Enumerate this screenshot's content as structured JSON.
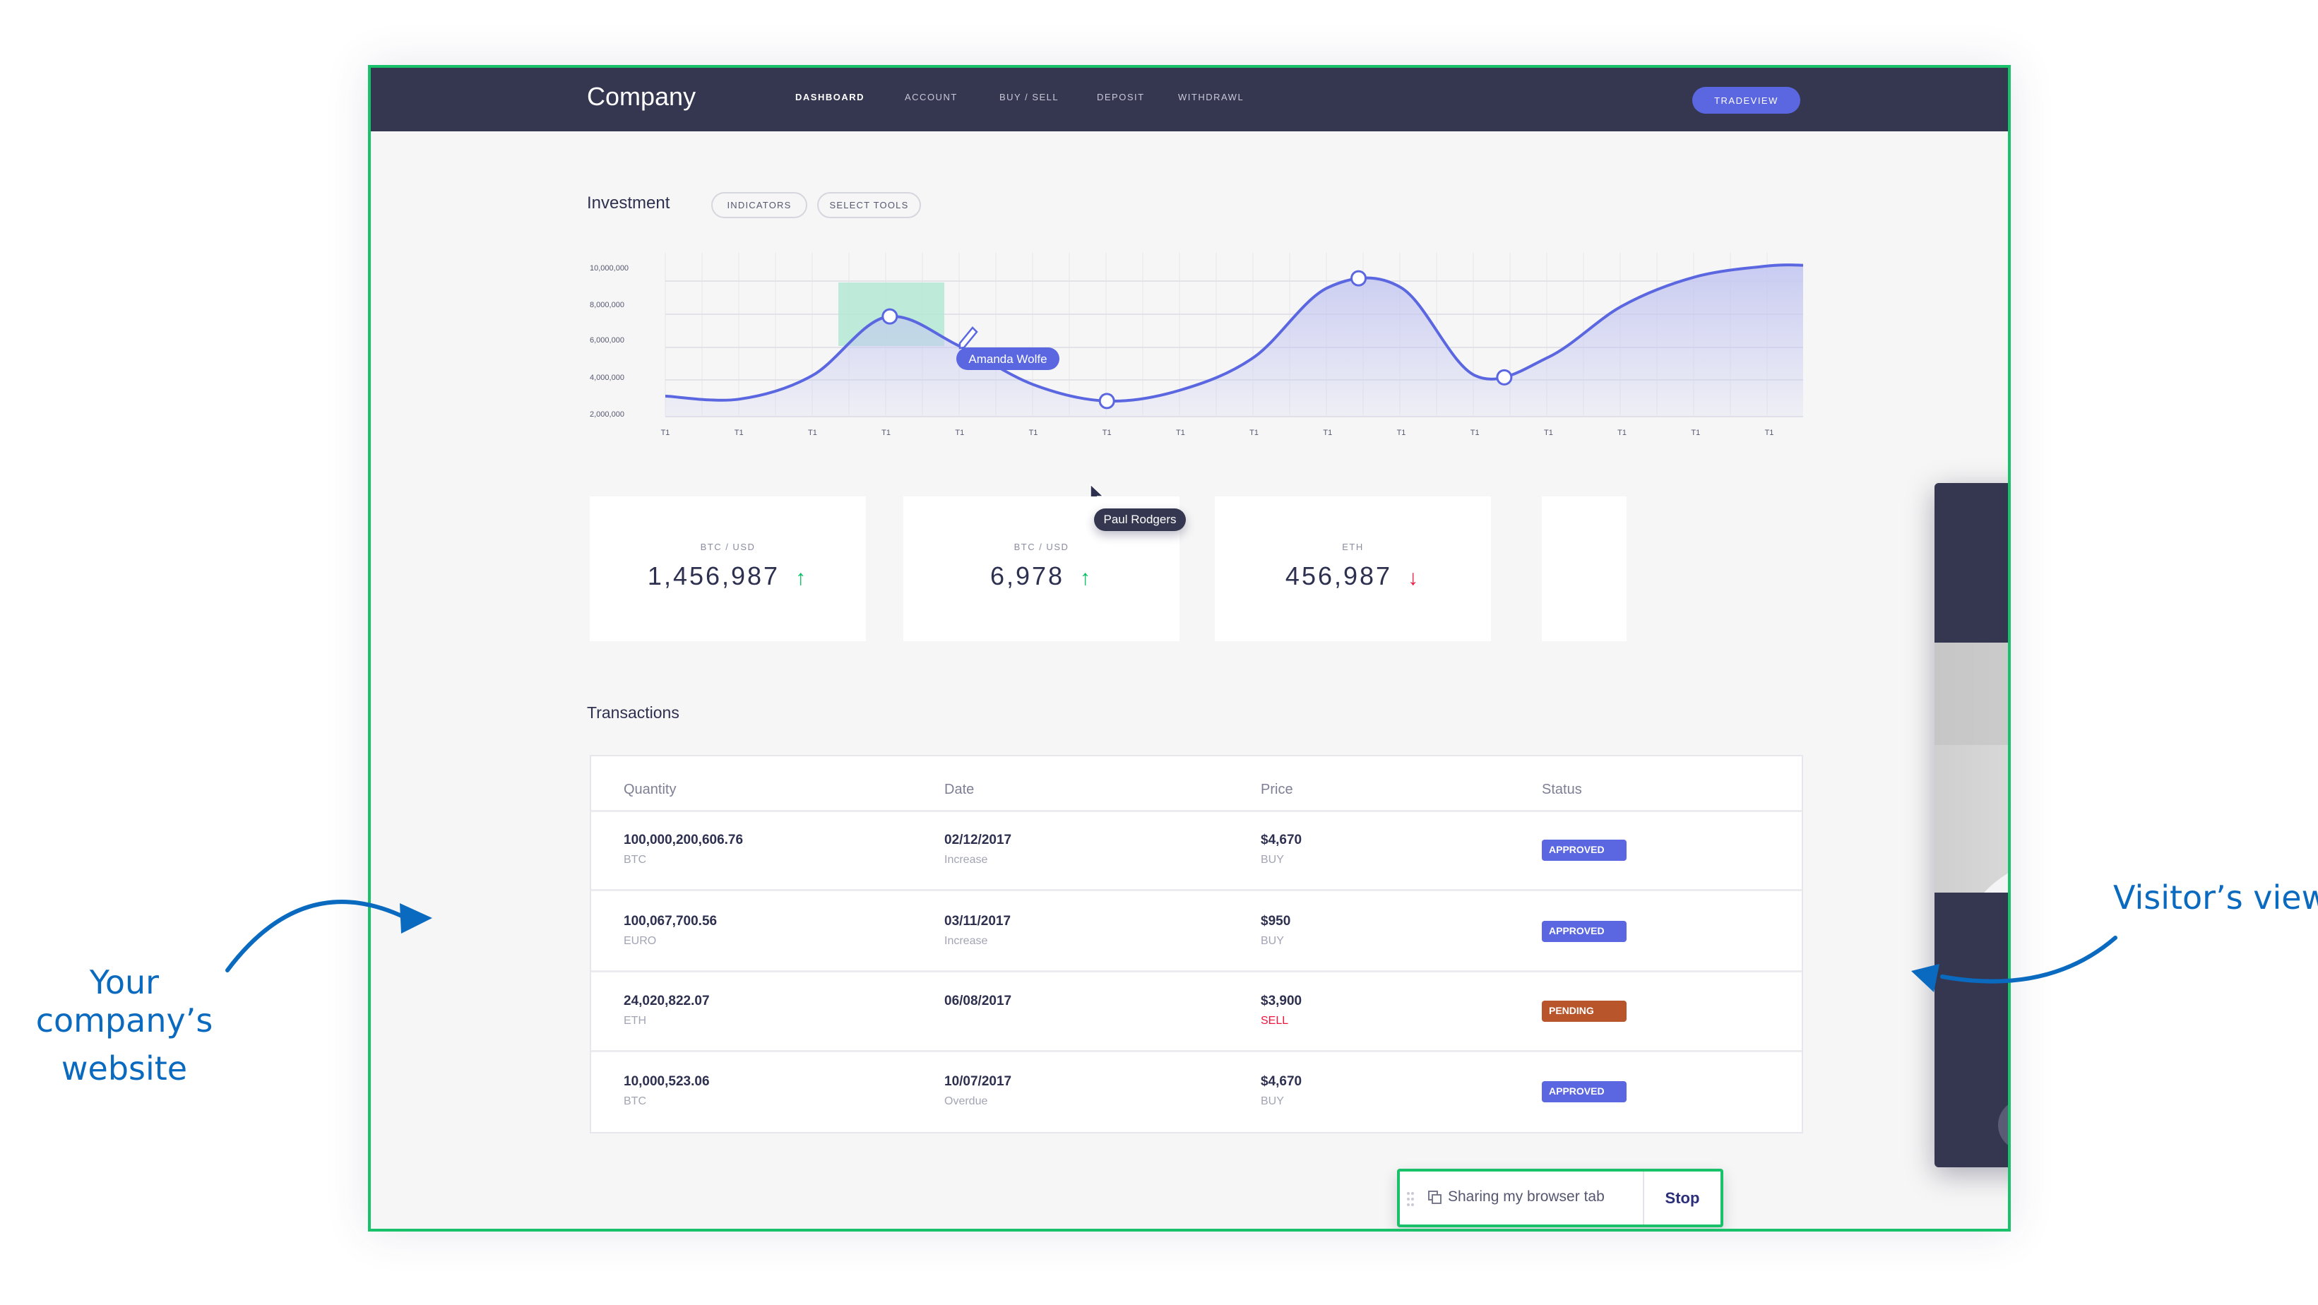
{
  "annotations": {
    "left_line1": "Your company’s",
    "left_line2": "website",
    "right": "Visitor’s view",
    "color": "#0a6abf"
  },
  "colors": {
    "nav": "#353650",
    "accent": "#5a67e0",
    "up": "#00c060",
    "down": "#f0143c",
    "frame_border": "#19c16a"
  },
  "header": {
    "brand": "Company",
    "nav": [
      {
        "label": "DASHBOARD",
        "active": true
      },
      {
        "label": "ACCOUNT"
      },
      {
        "label": "BUY / SELL"
      },
      {
        "label": "DEPOSIT"
      },
      {
        "label": "WITHDRAWL"
      }
    ],
    "cta": "TRADEVIEW"
  },
  "investment": {
    "title": "Investment",
    "buttons": [
      "INDICATORS",
      "SELECT TOOLS"
    ]
  },
  "chart_data": {
    "type": "area",
    "x": [
      "T1",
      "T1",
      "T1",
      "T1",
      "T1",
      "T1",
      "T1",
      "T1",
      "T1",
      "T1",
      "T1",
      "T1",
      "T1",
      "T1",
      "T1",
      "T1"
    ],
    "values": [
      2970000,
      2800000,
      4100000,
      7300000,
      5700000,
      3600000,
      2700000,
      3300000,
      5100000,
      8900000,
      8900000,
      4100000,
      5100000,
      7900000,
      9500000,
      10100000
    ],
    "yticks": [
      "10,000,000",
      "8,000,000",
      "6,000,000",
      "4,000,000",
      "2,000,000"
    ],
    "ylim": [
      2000000,
      10000000
    ],
    "grid": true,
    "line_color": "#5a67e0",
    "highlight_color": "#b3e8d3"
  },
  "cursors": {
    "amanda": "Amanda Wolfe",
    "paul": "Paul Rodgers"
  },
  "cards": [
    {
      "label": "BTC / USD",
      "value": "1,456,987",
      "trend": "up",
      "arrow": "↑"
    },
    {
      "label": "BTC / USD",
      "value": "6,978",
      "trend": "up",
      "arrow": "↑"
    },
    {
      "label": "ETH",
      "value": "456,987",
      "trend": "down",
      "arrow": "↓"
    }
  ],
  "transactions": {
    "title": "Transactions",
    "columns": [
      "Quantity",
      "Date",
      "Price",
      "Status"
    ],
    "rows": [
      {
        "qty": "100,000,200,606.76",
        "cur": "BTC",
        "date": "02/12/2017",
        "note": "Increase",
        "price": "$4,670",
        "side": "BUY",
        "status": "APPROVED",
        "status_color": "#5a67e0"
      },
      {
        "qty": "100,067,700.56",
        "cur": "EURO",
        "date": "03/11/2017",
        "note": "Increase",
        "price": "$950",
        "side": "BUY",
        "status": "APPROVED",
        "status_color": "#5a67e0"
      },
      {
        "qty": "24,020,822.07",
        "cur": "ETH",
        "date": "06/08/2017",
        "note": "",
        "price": "$3,900",
        "side": "SELL",
        "status": "PENDING",
        "status_color": "#b9552a"
      },
      {
        "qty": "10,000,523.06",
        "cur": "BTC",
        "date": "10/07/2017",
        "note": "Overdue",
        "price": "$4,670",
        "side": "BUY",
        "status": "APPROVED",
        "status_color": "#5a67e0"
      }
    ]
  },
  "share_bar": {
    "label": "Sharing my browser tab",
    "stop": "Stop"
  },
  "video": {
    "top_icons": [
      "camera-switch-icon",
      "chat-icon",
      "expand-icon"
    ],
    "controls": [
      "speaker-icon",
      "video-camera-icon",
      "microphone-icon",
      "hang-up-icon"
    ],
    "hangup_color": "#ff1a3c"
  }
}
